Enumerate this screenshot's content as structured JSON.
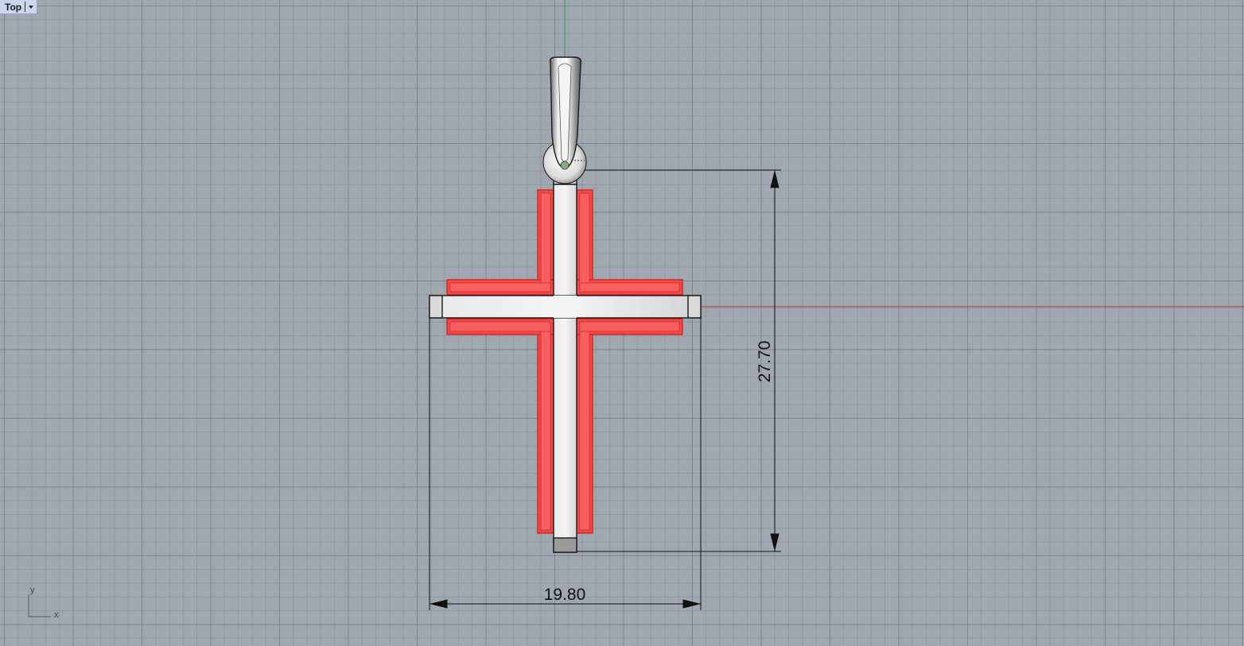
{
  "viewport": {
    "name": "Top"
  },
  "dimensions": {
    "height_value": "27.70",
    "width_value": "19.80"
  },
  "axes_icon": {
    "x_label": "x",
    "y_label": "y"
  },
  "colors": {
    "background": "#a1a7b0",
    "selected_highlight": "#f44848",
    "x_axis": "#b03a3a",
    "y_axis": "#3a9a3a"
  }
}
